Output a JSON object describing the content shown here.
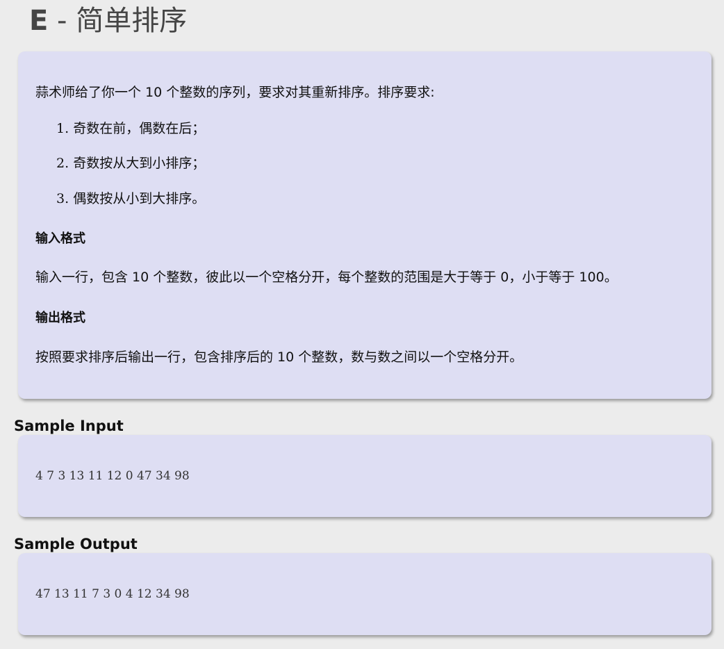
{
  "problem": {
    "title_prefix": "E",
    "title_sep": " - ",
    "title_name": "简单排序"
  },
  "description": {
    "intro": "蒜术师给了你一个 10 个整数的序列，要求对其重新排序。排序要求:",
    "requirements": [
      {
        "number": "1.",
        "text": "奇数在前，偶数在后；"
      },
      {
        "number": "2.",
        "text": "奇数按从大到小排序；"
      },
      {
        "number": "3.",
        "text": "偶数按从小到大排序。"
      }
    ],
    "input_heading": "输入格式",
    "input_text": "输入一行，包含 10 个整数，彼此以一个空格分开，每个整数的范围是大于等于 0，小于等于 100。",
    "output_heading": "输出格式",
    "output_text": "按照要求排序后输出一行，包含排序后的 10 个整数，数与数之间以一个空格分开。"
  },
  "sample_input": {
    "label": "Sample Input",
    "content": "4 7 3 13 11 12 0 47 34 98"
  },
  "sample_output": {
    "label": "Sample Output",
    "content": "47 13 11 7 3 0 4 12 34 98"
  },
  "colors": {
    "background": "#ececec",
    "card": "#dedef3",
    "title": "#454545"
  }
}
